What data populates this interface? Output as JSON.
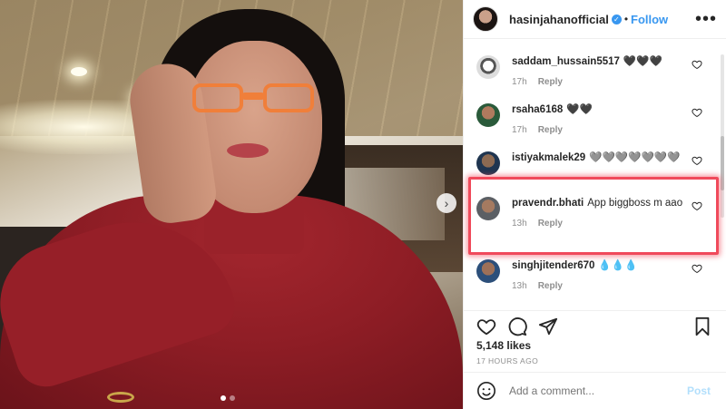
{
  "header": {
    "username": "hasinjahanofficial",
    "verified_mark": "✓",
    "separator": "•",
    "follow_label": "Follow",
    "more_label": "•••"
  },
  "comments": [
    {
      "username": "saddam_hussain5517",
      "text": "🖤🖤🖤",
      "age": "17h",
      "reply": "Reply"
    },
    {
      "username": "rsaha6168",
      "text": "🖤🖤",
      "age": "17h",
      "reply": "Reply"
    },
    {
      "username": "istiyakmalek29",
      "text": "🩶🩶🩶🩶🩶🩶🩶",
      "age": "",
      "reply": ""
    },
    {
      "username": "pravendr.bhati",
      "text": "App biggboss m aao",
      "age": "13h",
      "reply": "Reply"
    },
    {
      "username": "singhjitender670",
      "text": "💧💧💧",
      "age": "13h",
      "reply": "Reply"
    }
  ],
  "post": {
    "likes": "5,148 likes",
    "time": "17 HOURS AGO"
  },
  "composer": {
    "placeholder": "Add a comment...",
    "post_label": "Post"
  },
  "carousel": {
    "next_label": "›"
  },
  "colors": {
    "accent": "#3897f0",
    "highlight": "#f04a5b",
    "sweater": "#8e1d25"
  },
  "icons": [
    "more-icon",
    "verified-icon",
    "heart-icon",
    "comment-icon",
    "share-icon",
    "bookmark-icon",
    "emoji-icon",
    "carousel-next-icon"
  ]
}
